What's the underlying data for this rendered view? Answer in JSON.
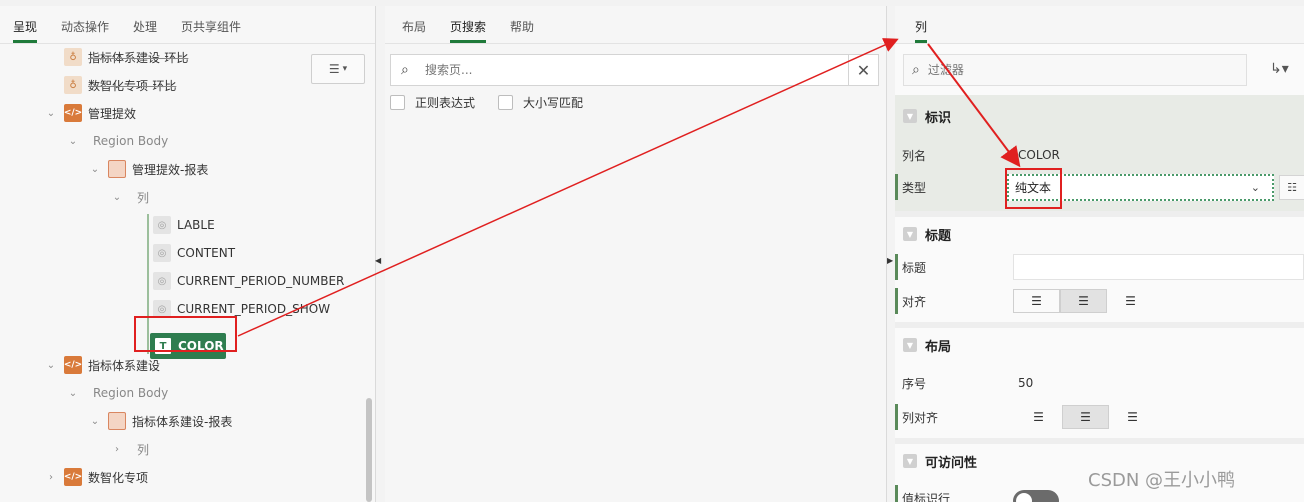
{
  "left": {
    "tabs": [
      "呈现",
      "动态操作",
      "处理",
      "页共享组件"
    ],
    "tree": {
      "item1": "指标体系建设-环比",
      "item2": "数智化专项-环比",
      "item3": "管理提效",
      "region_body_1": "Region Body",
      "report1": "管理提效-报表",
      "columns1": "列",
      "col_lable": "LABLE",
      "col_content": "CONTENT",
      "col_cpn": "CURRENT_PERIOD_NUMBER",
      "col_cps": "CURRENT_PERIOD_SHOW",
      "col_color": "COLOR",
      "item4": "指标体系建设",
      "region_body_2": "Region Body",
      "report2": "指标体系建设-报表",
      "columns2": "列",
      "item5": "数智化专项"
    },
    "menu_icon": "hamburger-icon"
  },
  "middle": {
    "tabs": [
      "布局",
      "页搜索",
      "帮助"
    ],
    "search_placeholder": "搜索页...",
    "regex_label": "正则表达式",
    "case_label": "大小写匹配"
  },
  "right": {
    "tab": "列",
    "filter_placeholder": "过滤器",
    "sections": {
      "identify": "标识",
      "heading": "标题",
      "layout": "布局",
      "accessibility": "可访问性"
    },
    "props": {
      "colname_label": "列名",
      "colname_value": "COLOR",
      "type_label": "类型",
      "type_value": "纯文本",
      "heading_label": "标题",
      "align_label": "对齐",
      "seq_label": "序号",
      "seq_value": "50",
      "col_align_label": "列对齐",
      "row_header_label": "值标识行"
    }
  },
  "watermark": "CSDN @王小小鸭",
  "colors": {
    "accent_green": "#2e7d4f",
    "annotation_red": "#e02020"
  }
}
